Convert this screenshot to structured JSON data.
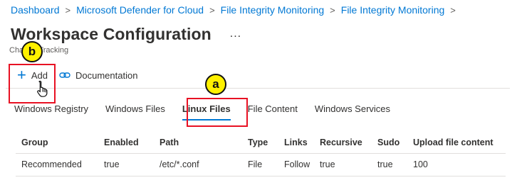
{
  "breadcrumb": {
    "items": [
      "Dashboard",
      "Microsoft Defender for Cloud",
      "File Integrity Monitoring",
      "File Integrity Monitoring"
    ],
    "separator": ">"
  },
  "header": {
    "title": "Workspace Configuration",
    "more": "...",
    "subtitle": "Change Tracking"
  },
  "toolbar": {
    "add_label": "Add",
    "documentation_label": "Documentation"
  },
  "tabs": [
    {
      "label": "Windows Registry",
      "active": false
    },
    {
      "label": "Windows Files",
      "active": false
    },
    {
      "label": "Linux Files",
      "active": true
    },
    {
      "label": "File Content",
      "active": false
    },
    {
      "label": "Windows Services",
      "active": false
    }
  ],
  "table": {
    "columns": [
      "Group",
      "Enabled",
      "Path",
      "Type",
      "Links",
      "Recursive",
      "Sudo",
      "Upload file content"
    ],
    "rows": [
      [
        "Recommended",
        "true",
        "/etc/*.conf",
        "File",
        "Follow",
        "true",
        "true",
        "100"
      ]
    ]
  },
  "annotations": {
    "a": "a",
    "b": "b",
    "callout_color": "#e81123",
    "badge_color": "#fff100"
  },
  "colors": {
    "accent": "#0078d4",
    "text": "#323130"
  },
  "icons": [
    "chevron-right-icon",
    "more-icon",
    "plus-icon",
    "link-icon",
    "hand-cursor-icon"
  ]
}
